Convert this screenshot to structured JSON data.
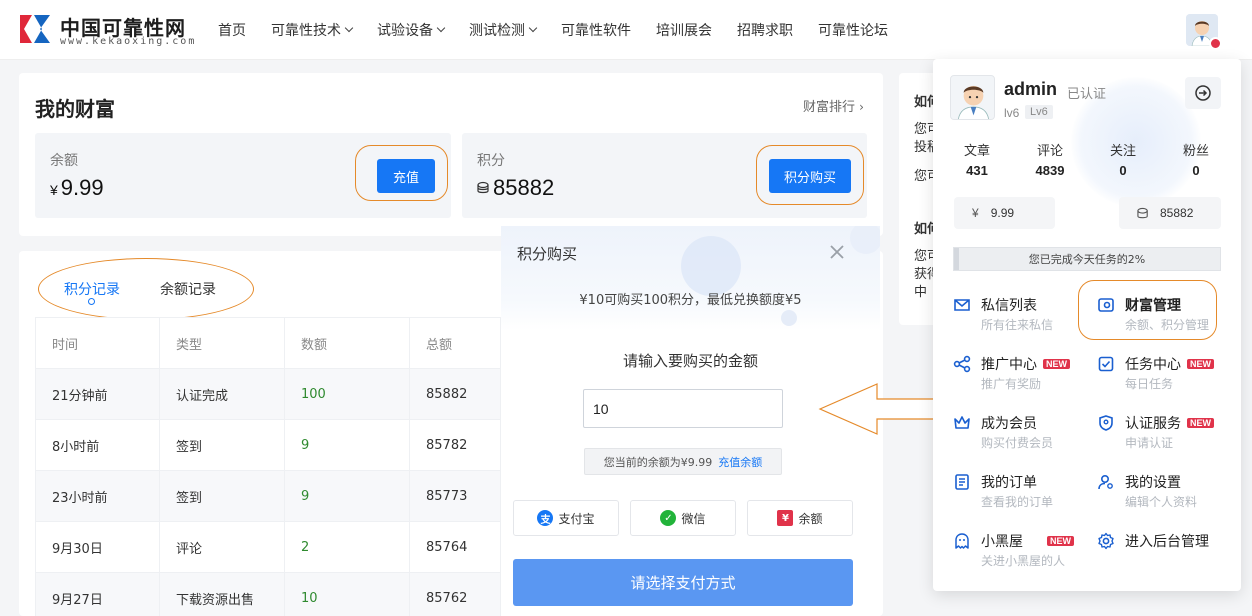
{
  "site": {
    "name_cn": "中国可靠性网",
    "name_en": "www.kekaoxing.com"
  },
  "nav": {
    "items": [
      {
        "label": "首页",
        "has_caret": false
      },
      {
        "label": "可靠性技术",
        "has_caret": true
      },
      {
        "label": "试验设备",
        "has_caret": true
      },
      {
        "label": "测试检测",
        "has_caret": true
      },
      {
        "label": "可靠性软件",
        "has_caret": false
      },
      {
        "label": "培训展会",
        "has_caret": false
      },
      {
        "label": "招聘求职",
        "has_caret": false
      },
      {
        "label": "可靠性论坛",
        "has_caret": false
      }
    ]
  },
  "wealth": {
    "title": "我的财富",
    "rank_link": "财富排行",
    "balance": {
      "label": "余额",
      "currency": "¥",
      "value": "9.99",
      "button": "充值"
    },
    "points": {
      "label": "积分",
      "value": "85882",
      "button": "积分购买"
    }
  },
  "records": {
    "tabs": [
      "积分记录",
      "余额记录"
    ],
    "active_tab": 0,
    "columns": [
      "时间",
      "类型",
      "数额",
      "总额"
    ],
    "rows": [
      {
        "time": "21分钟前",
        "type": "认证完成",
        "amount": "100",
        "total": "85882"
      },
      {
        "time": "8小时前",
        "type": "签到",
        "amount": "9",
        "total": "85782"
      },
      {
        "time": "23小时前",
        "type": "签到",
        "amount": "9",
        "total": "85773"
      },
      {
        "time": "9月30日",
        "type": "评论",
        "amount": "2",
        "total": "85764"
      },
      {
        "time": "9月27日",
        "type": "下载资源出售",
        "amount": "10",
        "total": "85762"
      }
    ]
  },
  "right_card": {
    "block1": [
      "如何",
      "您可",
      "投稿",
      "您可"
    ],
    "block2": [
      "如何",
      "您可",
      "获得",
      "中"
    ]
  },
  "modal": {
    "title": "积分购买",
    "desc": "¥10可购买100积分，最低兑换额度¥5",
    "prompt": "请输入要购买的金额",
    "input_value": "10",
    "balance_text": "您当前的余额为¥9.99",
    "recharge_link": "充值余额",
    "pay_options": [
      {
        "label": "支付宝",
        "icon": "alipay-icon",
        "color": "#1677f5"
      },
      {
        "label": "微信",
        "icon": "wechat-icon",
        "color": "#22b33a"
      },
      {
        "label": "余额",
        "icon": "balance-icon",
        "color": "#e0334a"
      }
    ],
    "submit": "请选择支付方式"
  },
  "user_panel": {
    "name": "admin",
    "verified": "已认证",
    "level": "lv6",
    "level_tag": "Lv6",
    "stats": [
      {
        "label": "文章",
        "value": "431"
      },
      {
        "label": "评论",
        "value": "4839"
      },
      {
        "label": "关注",
        "value": "0"
      },
      {
        "label": "粉丝",
        "value": "0"
      }
    ],
    "money": {
      "balance_symbol": "¥",
      "balance": "9.99",
      "points": "85882"
    },
    "task_progress_text": "您已完成今天任务的2%",
    "task_progress": 0.02,
    "menu": [
      {
        "title": "私信列表",
        "sub": "所有往来私信",
        "icon": "mail-icon",
        "new": false
      },
      {
        "title": "财富管理",
        "sub": "余额、积分管理",
        "icon": "wallet-icon",
        "new": false
      },
      {
        "title": "推广中心",
        "sub": "推广有奖励",
        "icon": "share-icon",
        "new": true
      },
      {
        "title": "任务中心",
        "sub": "每日任务",
        "icon": "task-icon",
        "new": true
      },
      {
        "title": "成为会员",
        "sub": "购买付费会员",
        "icon": "crown-icon",
        "new": false
      },
      {
        "title": "认证服务",
        "sub": "申请认证",
        "icon": "shield-icon",
        "new": true
      },
      {
        "title": "我的订单",
        "sub": "查看我的订单",
        "icon": "order-icon",
        "new": false
      },
      {
        "title": "我的设置",
        "sub": "编辑个人资料",
        "icon": "user-settings-icon",
        "new": false
      },
      {
        "title": "小黑屋",
        "sub": "关进小黑屋的人",
        "icon": "ghost-icon",
        "new": true
      },
      {
        "title": "进入后台管理",
        "sub": "",
        "icon": "gear-icon",
        "new": false
      }
    ],
    "new_label": "NEW"
  }
}
